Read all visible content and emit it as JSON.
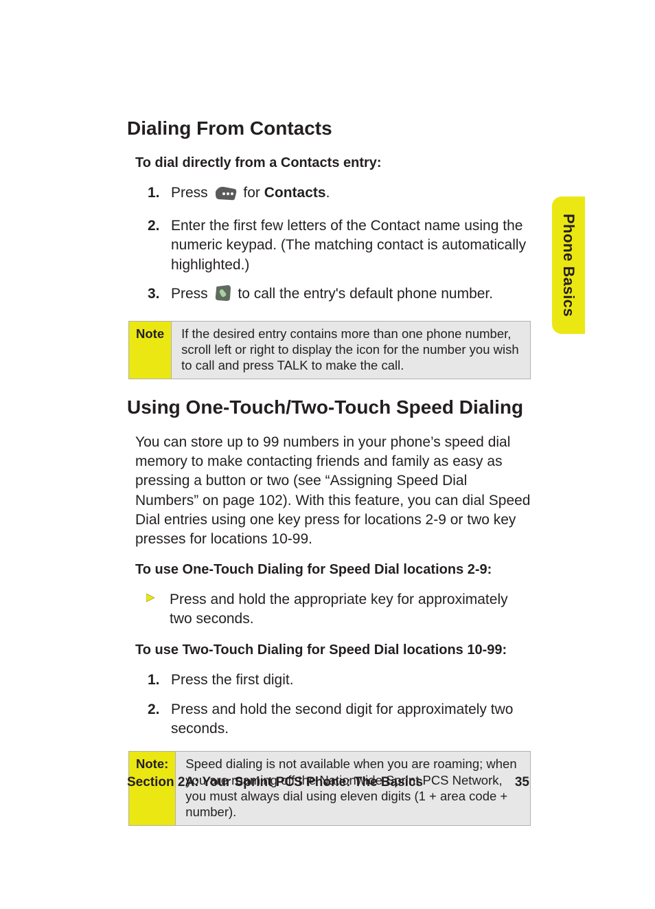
{
  "sideTab": "Phone Basics",
  "heading1": "Dialing From Contacts",
  "intro1": "To dial directly from a Contacts entry:",
  "steps1": {
    "n1": "1.",
    "s1a": "Press ",
    "s1b": " for ",
    "s1c": "Contacts",
    "s1d": ".",
    "n2": "2.",
    "s2": "Enter the first few letters of the Contact name using the numeric keypad. (The matching contact is automatically highlighted.)",
    "n3": "3.",
    "s3a": "Press ",
    "s3b": " to call the entry's default phone number."
  },
  "note1": {
    "label": "Note",
    "body": "If the desired entry contains more than one phone number, scroll left or right to display the icon for the number you wish to call and press TALK to make the call."
  },
  "heading2": "Using One-Touch/Two-Touch Speed Dialing",
  "para2": "You can store up to 99 numbers in your phone’s speed dial memory to make contacting friends and family as easy as pressing a button or two (see “Assigning Speed Dial Numbers” on page 102). With this feature, you can dial Speed Dial entries using one key press for locations 2-9 or two key presses for locations 10-99.",
  "intro2a": "To use One-Touch Dialing for Speed Dial locations 2-9:",
  "bullet2a": "Press and hold the appropriate key for approximately two seconds.",
  "intro2b": "To use Two-Touch Dialing for Speed Dial locations 10-99:",
  "steps2b": {
    "n1": "1.",
    "s1": "Press the first digit.",
    "n2": "2.",
    "s2": "Press and hold the second digit for approximately two seconds."
  },
  "note2": {
    "label": "Note:",
    "bodyA": "Speed dialing is not available when you are roaming; when you are roaming off the ",
    "bodyBold": "Nationwide Sprint PCS Network",
    "bodyB": ", you must always dial using eleven digits (1 + area code + number)."
  },
  "footer": {
    "left": "Section 2A: Your Sprint PCS Phone: The Basics",
    "right": "35"
  }
}
